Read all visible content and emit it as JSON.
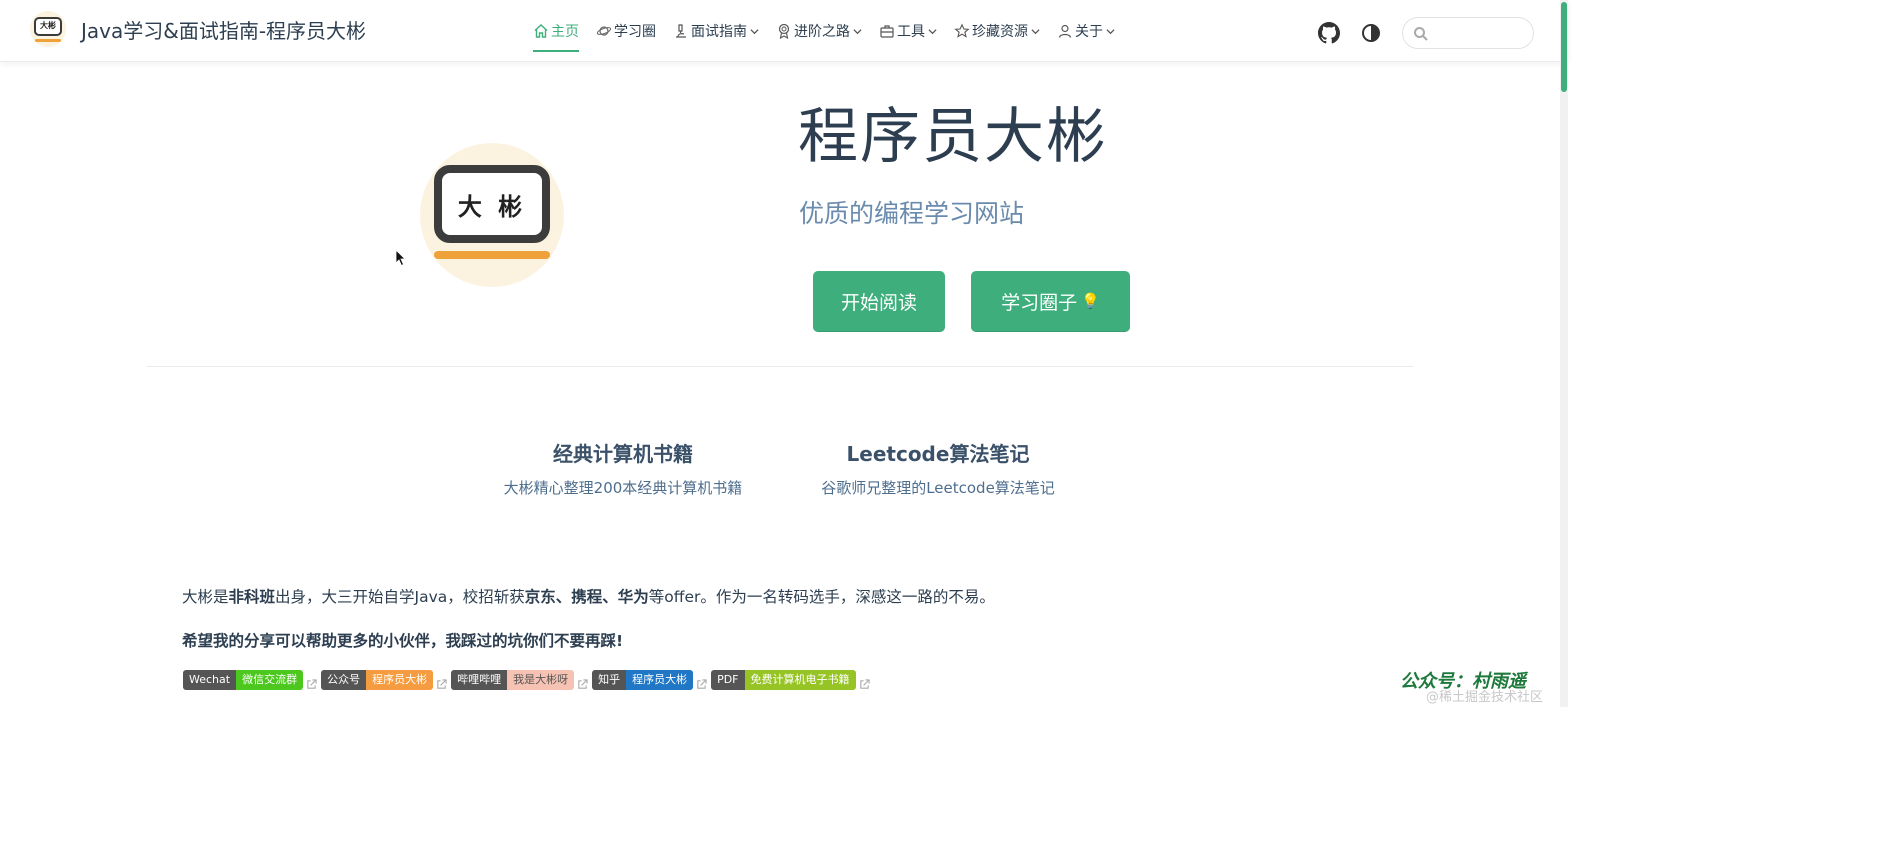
{
  "navbar": {
    "site_title": "Java学习&面试指南-程序员大彬",
    "logo_text": "大彬",
    "items": [
      {
        "label": "主页",
        "icon": "home-icon",
        "has_dropdown": false,
        "active": true
      },
      {
        "label": "学习圈",
        "icon": "planet-icon",
        "has_dropdown": false,
        "active": false
      },
      {
        "label": "面试指南",
        "icon": "microscope-icon",
        "has_dropdown": true,
        "active": false
      },
      {
        "label": "进阶之路",
        "icon": "medal-icon",
        "has_dropdown": true,
        "active": false
      },
      {
        "label": "工具",
        "icon": "toolbox-icon",
        "has_dropdown": true,
        "active": false
      },
      {
        "label": "珍藏资源",
        "icon": "star-icon",
        "has_dropdown": true,
        "active": false
      },
      {
        "label": "关于",
        "icon": "user-icon",
        "has_dropdown": true,
        "active": false
      }
    ],
    "search_placeholder": ""
  },
  "hero": {
    "logo_text": "大 彬",
    "title": "程序员大彬",
    "description": "优质的编程学习网站",
    "primary_action": "开始阅读",
    "secondary_action": "学习圈子",
    "secondary_icon": "💡"
  },
  "features": [
    {
      "title": "经典计算机书籍",
      "details": "大彬精心整理200本经典计算机书籍"
    },
    {
      "title": "Leetcode算法笔记",
      "details": "谷歌师兄整理的Leetcode算法笔记"
    }
  ],
  "intro": {
    "p1_a": "大彬是",
    "p1_b": "非科班",
    "p1_c": "出身，大三开始自学Java，校招斩获",
    "p1_d": "京东、携程、华为",
    "p1_e": "等offer。作为一名转码选手，深感这一路的不易。",
    "p2": "希望我的分享可以帮助更多的小伙伴，我踩过的坑你们不要再踩!"
  },
  "badges": [
    {
      "left": "Wechat",
      "right": "微信交流群",
      "color": "#4cc71e"
    },
    {
      "left": "公众号",
      "right": "程序员大彬",
      "color": "#f49c3f"
    },
    {
      "left": "哔哩哔哩",
      "right": "我是大彬呀",
      "color": "#f5b8a8"
    },
    {
      "left": "知乎",
      "right": "程序员大彬",
      "color": "#1f77c5"
    },
    {
      "left": "PDF",
      "right": "免费计算机电子书籍",
      "color": "#97c425"
    }
  ],
  "watermark": {
    "main": "公众号：村雨遥",
    "sub": "@稀土掘金技术社区"
  },
  "colors": {
    "accent": "#3eaf7c",
    "text": "#2c3e50",
    "muted": "#6a8bad"
  }
}
